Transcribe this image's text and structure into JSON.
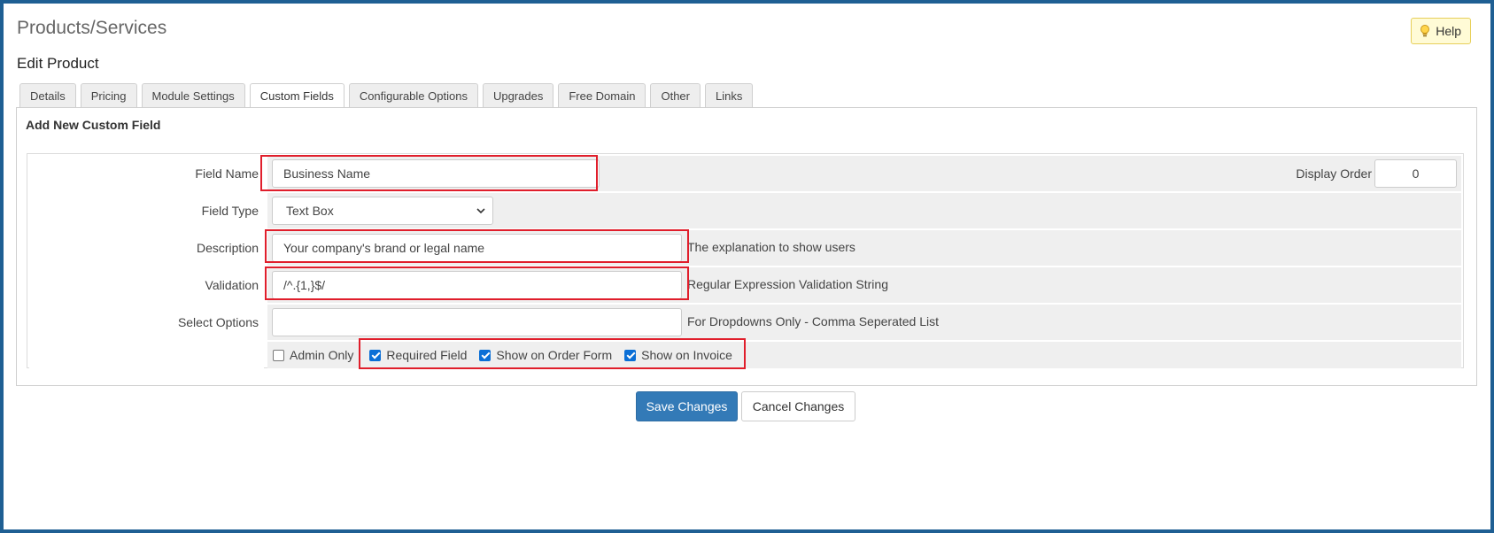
{
  "page": {
    "title": "Products/Services",
    "subtitle": "Edit Product",
    "help_label": "Help"
  },
  "tabs": [
    {
      "label": "Details",
      "active": false
    },
    {
      "label": "Pricing",
      "active": false
    },
    {
      "label": "Module Settings",
      "active": false
    },
    {
      "label": "Custom Fields",
      "active": true
    },
    {
      "label": "Configurable Options",
      "active": false
    },
    {
      "label": "Upgrades",
      "active": false
    },
    {
      "label": "Free Domain",
      "active": false
    },
    {
      "label": "Other",
      "active": false
    },
    {
      "label": "Links",
      "active": false
    }
  ],
  "section": {
    "heading": "Add New Custom Field"
  },
  "form": {
    "field_name": {
      "label": "Field Name",
      "value": "Business Name"
    },
    "display_order": {
      "label": "Display Order",
      "value": "0"
    },
    "field_type": {
      "label": "Field Type",
      "value": "Text Box"
    },
    "description": {
      "label": "Description",
      "value": "Your company's brand or legal name",
      "hint": "The explanation to show users"
    },
    "validation": {
      "label": "Validation",
      "value": "/^.{1,}$/",
      "hint": "Regular Expression Validation String"
    },
    "select_options": {
      "label": "Select Options",
      "value": "",
      "hint": "For Dropdowns Only - Comma Seperated List"
    },
    "checkboxes": [
      {
        "label": "Admin Only",
        "checked": false
      },
      {
        "label": "Required Field",
        "checked": true
      },
      {
        "label": "Show on Order Form",
        "checked": true
      },
      {
        "label": "Show on Invoice",
        "checked": true
      }
    ]
  },
  "actions": {
    "save_label": "Save Changes",
    "cancel_label": "Cancel Changes"
  },
  "colors": {
    "highlight": "#e01e2b",
    "primary_button": "#337ab7",
    "checkbox_checked": "#0b6fd6",
    "help_bg": "#fffbd6"
  }
}
